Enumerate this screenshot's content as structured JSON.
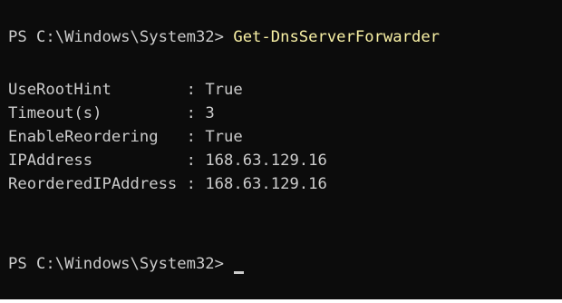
{
  "prompt_text": "PS C:\\Windows\\System32> ",
  "command": "Get-DnsServerForwarder",
  "properties": [
    {
      "name": "UseRootHint",
      "value": "True"
    },
    {
      "name": "Timeout(s)",
      "value": "3"
    },
    {
      "name": "EnableReordering",
      "value": "True"
    },
    {
      "name": "IPAddress",
      "value": "168.63.129.16"
    },
    {
      "name": "ReorderedIPAddress",
      "value": "168.63.129.16"
    }
  ],
  "separator": " : ",
  "colors": {
    "background": "#0c0c0c",
    "text": "#cccccc",
    "command": "#f9f1a5"
  }
}
